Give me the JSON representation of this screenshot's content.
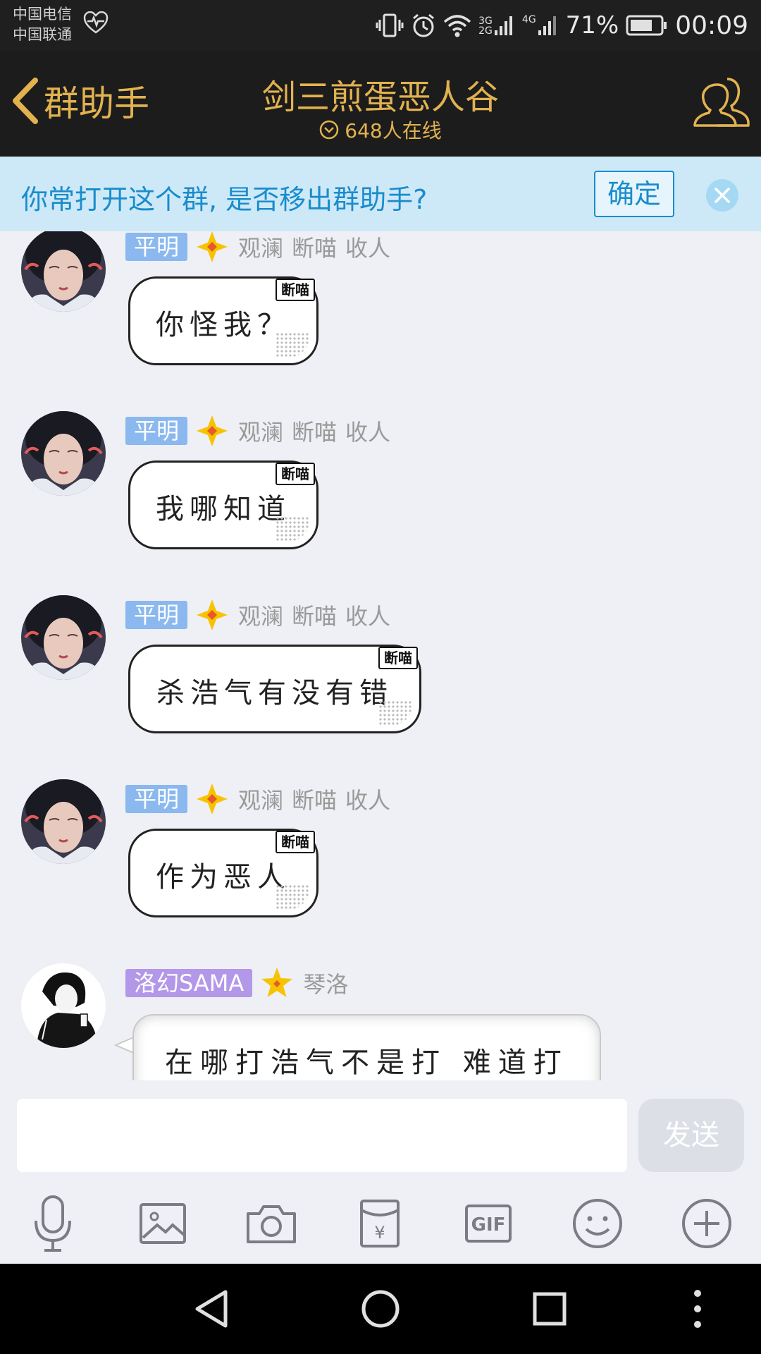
{
  "status_bar": {
    "carrier_1": "中国电信",
    "carrier_2": "中国联通",
    "net_3g": "3G",
    "net_2g": "2G",
    "net_4g": "4G",
    "battery_percent": "71%",
    "time": "00:09"
  },
  "header": {
    "back_label": "群助手",
    "title": "剑三煎蛋恶人谷",
    "online": "648人在线"
  },
  "notice": {
    "text": "你常打开这个群, 是否移出群助手?",
    "confirm": "确定"
  },
  "messages": [
    {
      "badge": "平明",
      "tags": [
        "观澜",
        "断喵",
        "收人"
      ],
      "bubble_tag": "断喵",
      "text": "你怪我？"
    },
    {
      "badge": "平明",
      "tags": [
        "观澜",
        "断喵",
        "收人"
      ],
      "bubble_tag": "断喵",
      "text": "我哪知道"
    },
    {
      "badge": "平明",
      "tags": [
        "观澜",
        "断喵",
        "收人"
      ],
      "bubble_tag": "断喵",
      "text": "杀浩气有没有错"
    },
    {
      "badge": "平明",
      "tags": [
        "观澜",
        "断喵",
        "收人"
      ],
      "bubble_tag": "断喵",
      "text": "作为恶人"
    },
    {
      "badge": "洛幻SAMA",
      "tags": [
        "琴洛"
      ],
      "text": "在哪打浩气不是打 难道打"
    }
  ],
  "input": {
    "send": "发送",
    "gif": "GIF",
    "yen": "¥"
  },
  "colors": {
    "accent_gold": "#e2b24f",
    "notice_blue": "#1a8ccc",
    "badge_blue": "#8ab8ef",
    "badge_purple": "#b397e8"
  }
}
